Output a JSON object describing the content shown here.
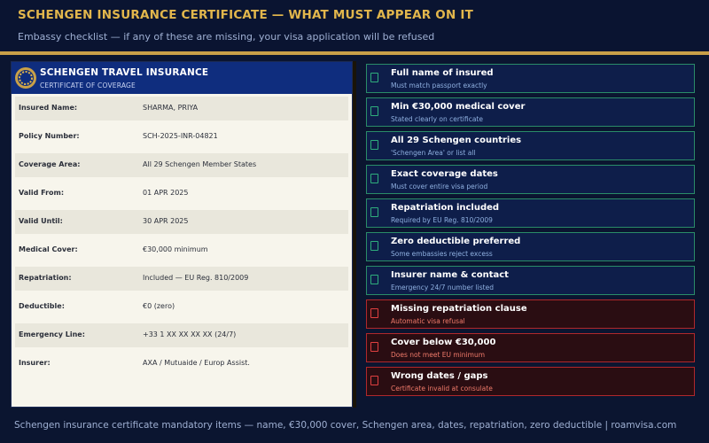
{
  "header": {
    "title": "SCHENGEN INSURANCE CERTIFICATE — WHAT MUST APPEAR ON IT",
    "subtitle": "Embassy checklist — if any of these are missing, your visa application will be refused"
  },
  "certificate": {
    "title": "SCHENGEN TRAVEL INSURANCE",
    "subtitle": "CERTIFICATE OF COVERAGE",
    "rows": [
      {
        "label": "Insured Name:",
        "value": "SHARMA, PRIYA"
      },
      {
        "label": "Policy Number:",
        "value": "SCH-2025-INR-04821"
      },
      {
        "label": "Coverage Area:",
        "value": "All 29 Schengen Member States"
      },
      {
        "label": "Valid From:",
        "value": "01 APR 2025"
      },
      {
        "label": "Valid Until:",
        "value": "30 APR 2025"
      },
      {
        "label": "Medical Cover:",
        "value": "€30,000 minimum"
      },
      {
        "label": "Repatriation:",
        "value": "Included — EU Reg. 810/2009"
      },
      {
        "label": "Deductible:",
        "value": "€0 (zero)"
      },
      {
        "label": "Emergency Line:",
        "value": "+33 1 XX XX XX XX (24/7)"
      },
      {
        "label": "Insurer:",
        "value": "AXA / Mutuaide / Europ Assist."
      }
    ]
  },
  "checklist": [
    {
      "title": "Full name of insured",
      "desc": "Must match passport exactly",
      "status": "required"
    },
    {
      "title": "Min €30,000 medical cover",
      "desc": "Stated clearly on certificate",
      "status": "required"
    },
    {
      "title": "All 29 Schengen countries",
      "desc": "'Schengen Area' or list all",
      "status": "required"
    },
    {
      "title": "Exact coverage dates",
      "desc": "Must cover entire visa period",
      "status": "required"
    },
    {
      "title": "Repatriation included",
      "desc": "Required by EU Reg. 810/2009",
      "status": "required"
    },
    {
      "title": "Zero deductible preferred",
      "desc": "Some embassies reject excess",
      "status": "required"
    },
    {
      "title": "Insurer name & contact",
      "desc": "Emergency 24/7 number listed",
      "status": "required"
    },
    {
      "title": "Missing repatriation clause",
      "desc": "Automatic visa refusal",
      "status": "refusal"
    },
    {
      "title": "Cover below €30,000",
      "desc": "Does not meet EU minimum",
      "status": "refusal"
    },
    {
      "title": "Wrong dates / gaps",
      "desc": "Certificate invalid at consulate",
      "status": "refusal"
    }
  ],
  "footer": "Schengen insurance certificate mandatory items — name, €30,000 cover, Schengen area, dates, repatriation, zero deductible | roamvisa.com",
  "colors": {
    "accent_gold": "#e2b64c",
    "cert_header_blue": "#0f2d7e",
    "ok_border": "#2a8c68",
    "bad_border": "#b0282c"
  }
}
